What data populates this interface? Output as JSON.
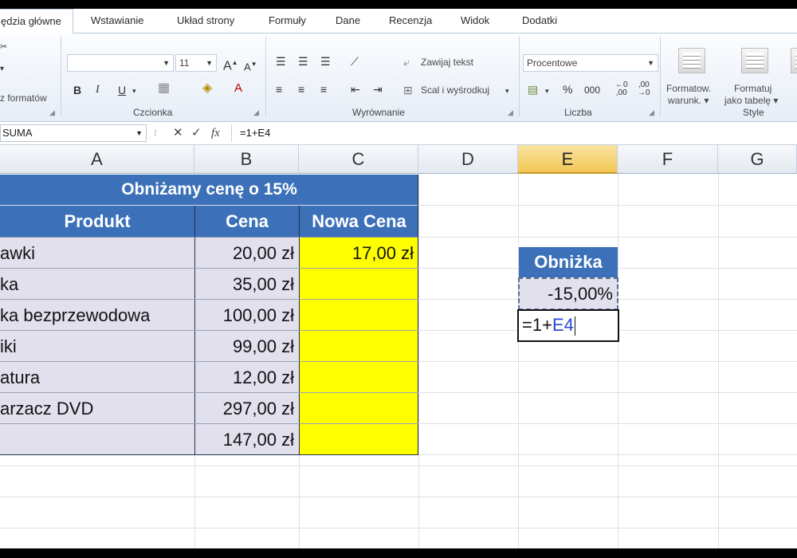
{
  "ribbon": {
    "tabs": [
      "ędzia główne",
      "Wstawianie",
      "Układ strony",
      "Formuły",
      "Dane",
      "Recenzja",
      "Widok",
      "Dodatki"
    ],
    "clipboard_fragment": "z formatów",
    "font_name": "",
    "font_size": "11",
    "wrap_text": "Zawijaj tekst",
    "merge_center": "Scal i wyśrodkuj",
    "number_format": "Procentowe",
    "percent_sign": "%",
    "thousands": "000",
    "cond_format_line1": "Formatow.",
    "cond_format_line2": "warunk.",
    "format_table_line1": "Formatuj",
    "format_table_line2": "jako tabelę",
    "groups": {
      "font": "Czcionka",
      "alignment": "Wyrównanie",
      "number": "Liczba",
      "styles": "Style"
    }
  },
  "formula_bar": {
    "name_box": "SUMA",
    "cancel": "✕",
    "enter": "✓",
    "fx": "fx",
    "content": "=1+E4"
  },
  "columns": [
    "A",
    "B",
    "C",
    "D",
    "E",
    "F",
    "G"
  ],
  "selected_column": "E",
  "table": {
    "title": "Obniżamy cenę o 15%",
    "headers": {
      "product": "Produkt",
      "price": "Cena",
      "new_price": "Nowa Cena"
    },
    "rows": [
      {
        "product": "awki",
        "price": "20,00 zł",
        "new_price": "17,00 zł"
      },
      {
        "product": "ka",
        "price": "35,00 zł",
        "new_price": ""
      },
      {
        "product": "ka bezprzewodowa",
        "price": "100,00 zł",
        "new_price": ""
      },
      {
        "product": "iki",
        "price": "99,00 zł",
        "new_price": ""
      },
      {
        "product": "atura",
        "price": "12,00 zł",
        "new_price": ""
      },
      {
        "product": "arzacz DVD",
        "price": "297,00 zł",
        "new_price": ""
      },
      {
        "product": "",
        "price": "147,00 zł",
        "new_price": ""
      }
    ]
  },
  "discount": {
    "header": "Obniżka",
    "value": "-15,00%"
  },
  "editing_cell": {
    "prefix": "=1+",
    "reference": "E4"
  },
  "colors": {
    "header_blue": "#3c71b9",
    "product_fill": "#e3e0ee",
    "highlight_yellow": "#ffff00",
    "selected_col_header": "#f2c654",
    "reference_blue": "#2a46d8"
  }
}
